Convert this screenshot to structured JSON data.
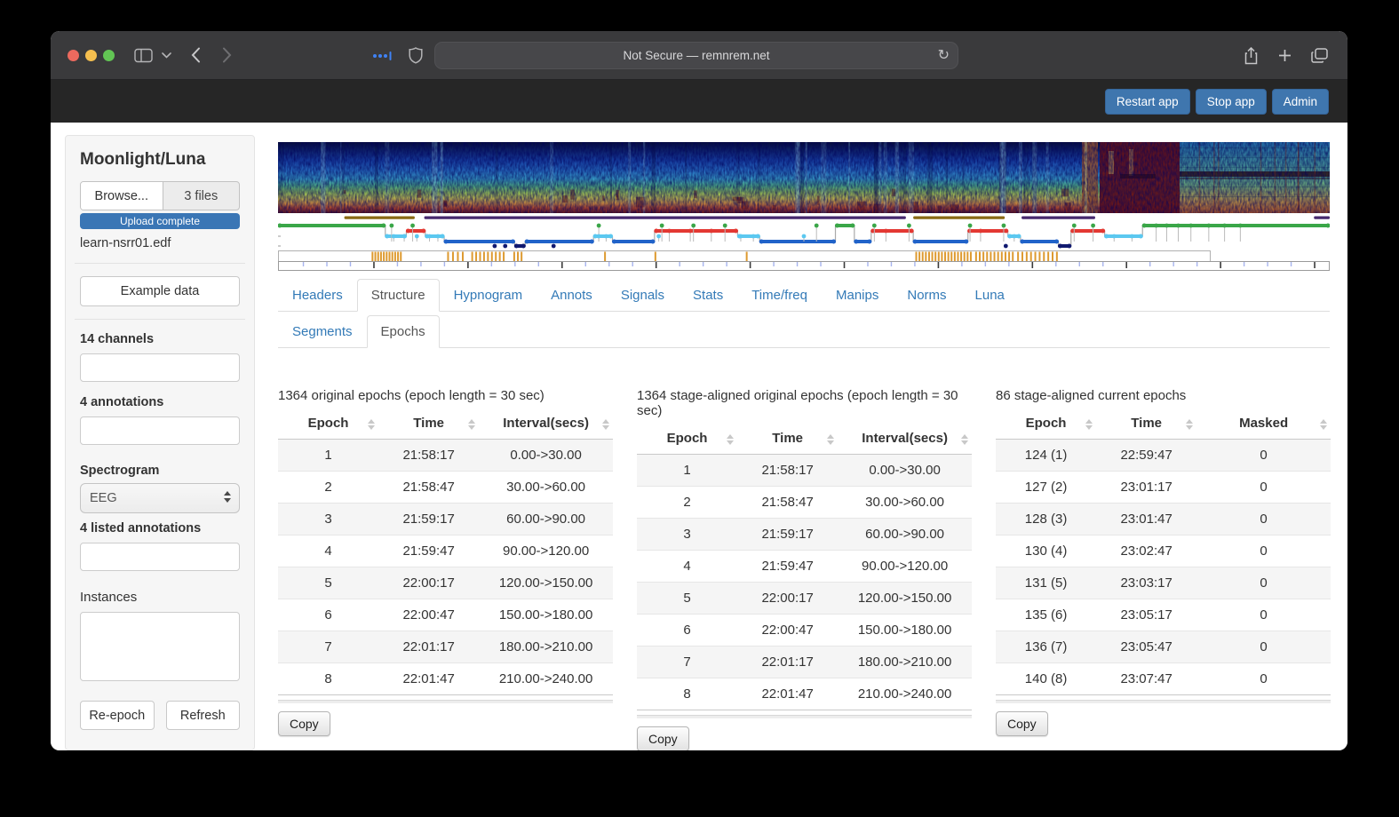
{
  "browser": {
    "url_text": "Not Secure — remnrem.net"
  },
  "app_header": {
    "buttons": [
      "Restart app",
      "Stop app",
      "Admin"
    ]
  },
  "sidebar": {
    "title": "Moonlight/Luna",
    "browse_label": "Browse...",
    "files_label": "3 files",
    "progress_label": "Upload complete",
    "filename": "learn-nsrr01.edf",
    "example_button": "Example data",
    "channels_label": "14 channels",
    "annotations_label": "4 annotations",
    "spectrogram_label": "Spectrogram",
    "spectrogram_selected": "EEG",
    "listed_annotations_label": "4 listed annotations",
    "instances_label": "Instances",
    "reepoch_button": "Re-epoch",
    "refresh_button": "Refresh"
  },
  "tabs": {
    "main": [
      {
        "label": "Headers",
        "active": false
      },
      {
        "label": "Structure",
        "active": true
      },
      {
        "label": "Hypnogram",
        "active": false
      },
      {
        "label": "Annots",
        "active": false
      },
      {
        "label": "Signals",
        "active": false
      },
      {
        "label": "Stats",
        "active": false
      },
      {
        "label": "Time/freq",
        "active": false
      },
      {
        "label": "Manips",
        "active": false
      },
      {
        "label": "Norms",
        "active": false
      },
      {
        "label": "Luna",
        "active": false
      }
    ],
    "sub": [
      {
        "label": "Segments",
        "active": false
      },
      {
        "label": "Epochs",
        "active": true
      }
    ]
  },
  "tables": [
    {
      "caption": "1364 original epochs (epoch length = 30 sec)",
      "columns": [
        "Epoch",
        "Time",
        "Interval(secs)"
      ],
      "rows": [
        [
          "1",
          "21:58:17",
          "0.00->30.00"
        ],
        [
          "2",
          "21:58:47",
          "30.00->60.00"
        ],
        [
          "3",
          "21:59:17",
          "60.00->90.00"
        ],
        [
          "4",
          "21:59:47",
          "90.00->120.00"
        ],
        [
          "5",
          "22:00:17",
          "120.00->150.00"
        ],
        [
          "6",
          "22:00:47",
          "150.00->180.00"
        ],
        [
          "7",
          "22:01:17",
          "180.00->210.00"
        ],
        [
          "8",
          "22:01:47",
          "210.00->240.00"
        ]
      ],
      "copy_label": "Copy"
    },
    {
      "caption": "1364 stage-aligned original epochs (epoch length = 30 sec)",
      "columns": [
        "Epoch",
        "Time",
        "Interval(secs)"
      ],
      "rows": [
        [
          "1",
          "21:58:17",
          "0.00->30.00"
        ],
        [
          "2",
          "21:58:47",
          "30.00->60.00"
        ],
        [
          "3",
          "21:59:17",
          "60.00->90.00"
        ],
        [
          "4",
          "21:59:47",
          "90.00->120.00"
        ],
        [
          "5",
          "22:00:17",
          "120.00->150.00"
        ],
        [
          "6",
          "22:00:47",
          "150.00->180.00"
        ],
        [
          "7",
          "22:01:17",
          "180.00->210.00"
        ],
        [
          "8",
          "22:01:47",
          "210.00->240.00"
        ]
      ],
      "copy_label": "Copy"
    },
    {
      "caption": "86 stage-aligned current epochs",
      "columns": [
        "Epoch",
        "Time",
        "Masked"
      ],
      "rows": [
        [
          "124 (1)",
          "22:59:47",
          "0"
        ],
        [
          "127 (2)",
          "23:01:17",
          "0"
        ],
        [
          "128 (3)",
          "23:01:47",
          "0"
        ],
        [
          "130 (4)",
          "23:02:47",
          "0"
        ],
        [
          "131 (5)",
          "23:03:17",
          "0"
        ],
        [
          "135 (6)",
          "23:05:17",
          "0"
        ],
        [
          "136 (7)",
          "23:05:47",
          "0"
        ],
        [
          "140 (8)",
          "23:07:47",
          "0"
        ]
      ],
      "copy_label": "Copy"
    }
  ],
  "tracks": {
    "stage_colors": {
      "W": "#3aa648",
      "R": "#e33832",
      "N1": "#5bc8f0",
      "N2": "#2163c9",
      "N3": "#111a70"
    },
    "bar_colors": {
      "brown": "#8a6a14",
      "purple": "#46286e"
    },
    "bars": [
      {
        "color": "brown",
        "start": 0.063,
        "end": 0.13
      },
      {
        "color": "purple",
        "start": 0.139,
        "end": 0.597
      },
      {
        "color": "brown",
        "start": 0.604,
        "end": 0.691
      },
      {
        "color": "purple",
        "start": 0.707,
        "end": 0.777
      },
      {
        "color": "purple",
        "start": 0.985,
        "end": 1.0
      }
    ],
    "hypnogram": [
      [
        "W",
        0.0,
        0.102
      ],
      [
        "N1",
        0.102,
        0.122
      ],
      [
        "R",
        0.122,
        0.14
      ],
      [
        "N1",
        0.14,
        0.158
      ],
      [
        "N2",
        0.158,
        0.225
      ],
      [
        "N3",
        0.225,
        0.235
      ],
      [
        "N2",
        0.235,
        0.3
      ],
      [
        "N1",
        0.3,
        0.318
      ],
      [
        "N2",
        0.318,
        0.358
      ],
      [
        "R",
        0.358,
        0.437
      ],
      [
        "N1",
        0.437,
        0.458
      ],
      [
        "N2",
        0.458,
        0.53
      ],
      [
        "W",
        0.53,
        0.548
      ],
      [
        "N2",
        0.548,
        0.564
      ],
      [
        "R",
        0.564,
        0.604
      ],
      [
        "N2",
        0.604,
        0.656
      ],
      [
        "R",
        0.656,
        0.694
      ],
      [
        "N1",
        0.694,
        0.706
      ],
      [
        "N2",
        0.706,
        0.742
      ],
      [
        "N3",
        0.742,
        0.754
      ],
      [
        "R",
        0.754,
        0.786
      ],
      [
        "N1",
        0.786,
        0.822
      ],
      [
        "W",
        0.822,
        1.0
      ]
    ],
    "extra_dots": {
      "W": [
        0.108,
        0.128,
        0.305,
        0.365,
        0.395,
        0.425,
        0.512,
        0.567,
        0.6,
        0.658,
        0.69,
        0.757,
        0.775,
        0.835,
        0.845,
        0.856,
        0.868,
        0.885,
        0.9,
        0.915
      ],
      "N1": [
        0.11,
        0.12,
        0.132,
        0.144,
        0.152,
        0.305,
        0.312,
        0.362,
        0.44,
        0.452,
        0.5,
        0.7,
        0.795,
        0.812
      ],
      "N3": [
        0.206,
        0.216,
        0.262,
        0.692
      ],
      "R": [
        0.372,
        0.392,
        0.412,
        0.578,
        0.668
      ]
    },
    "arousal_clusters": [
      [
        0.09,
        0.117,
        11
      ],
      [
        0.162,
        0.176,
        4
      ],
      [
        0.185,
        0.215,
        9
      ],
      [
        0.225,
        0.232,
        3
      ],
      [
        0.31,
        0.313,
        1
      ],
      [
        0.358,
        0.361,
        1
      ],
      [
        0.445,
        0.448,
        1
      ],
      [
        0.608,
        0.66,
        18
      ],
      [
        0.665,
        0.7,
        11
      ],
      [
        0.705,
        0.742,
        10
      ]
    ],
    "timeline": {
      "first_major": 0.0905,
      "major_step": 0.0896,
      "minors_per_major": 4
    }
  }
}
